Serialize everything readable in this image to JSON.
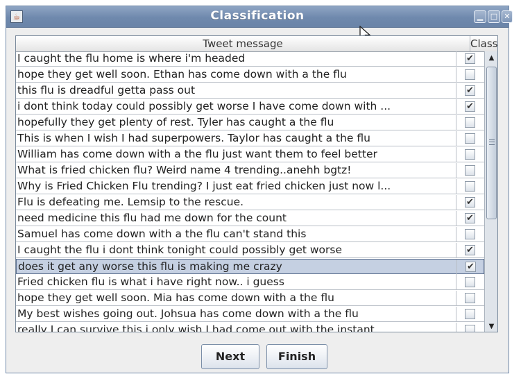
{
  "window": {
    "title": "Classification",
    "app_icon": "java-icon",
    "controls": {
      "minimize": "minimize-icon",
      "maximize": "maximize-icon",
      "close": "close-icon"
    }
  },
  "table": {
    "columns": {
      "message": "Tweet message",
      "class": "Class"
    },
    "rows": [
      {
        "message": "I caught the flu home is where i'm headed",
        "checked": true
      },
      {
        "message": "hope they get well soon. Ethan has come down with a the flu",
        "checked": false
      },
      {
        "message": "this flu is dreadful getta pass out",
        "checked": true
      },
      {
        "message": "i dont think today could possibly get worse I have come down with ...",
        "checked": true
      },
      {
        "message": "hopefully they get plenty of rest. Tyler has caught a the flu",
        "checked": false
      },
      {
        "message": "This is when I wish I had superpowers. Taylor has caught a the flu",
        "checked": false
      },
      {
        "message": "William has come down with a the flu just want them to feel better",
        "checked": false
      },
      {
        "message": "What is fried chicken flu? Weird name 4 trending..anehh bgtz!",
        "checked": false
      },
      {
        "message": "Why is Fried Chicken Flu trending? I just eat fried chicken just now l...",
        "checked": false
      },
      {
        "message": "Flu is defeating me. Lemsip to the rescue.",
        "checked": true
      },
      {
        "message": "need medicine this flu had me down for the count",
        "checked": true
      },
      {
        "message": "Samuel has come down with a the flu can't stand this",
        "checked": false
      },
      {
        "message": "I caught the flu i dont think tonight could possibly get worse",
        "checked": true
      },
      {
        "message": "does it get any worse this flu is making me crazy",
        "checked": true,
        "selected": true
      },
      {
        "message": "Fried chicken flu is what i have right now.. i guess",
        "checked": false
      },
      {
        "message": "hope they get well soon. Mia has come down with a the flu",
        "checked": false
      },
      {
        "message": "My best wishes going out. Johsua has come down with a the flu",
        "checked": false
      },
      {
        "message": "really I can survive this i only wish I had come out with the instant...",
        "checked": false
      }
    ]
  },
  "buttons": {
    "next": "Next",
    "finish": "Finish"
  },
  "check_glyph": "✔"
}
